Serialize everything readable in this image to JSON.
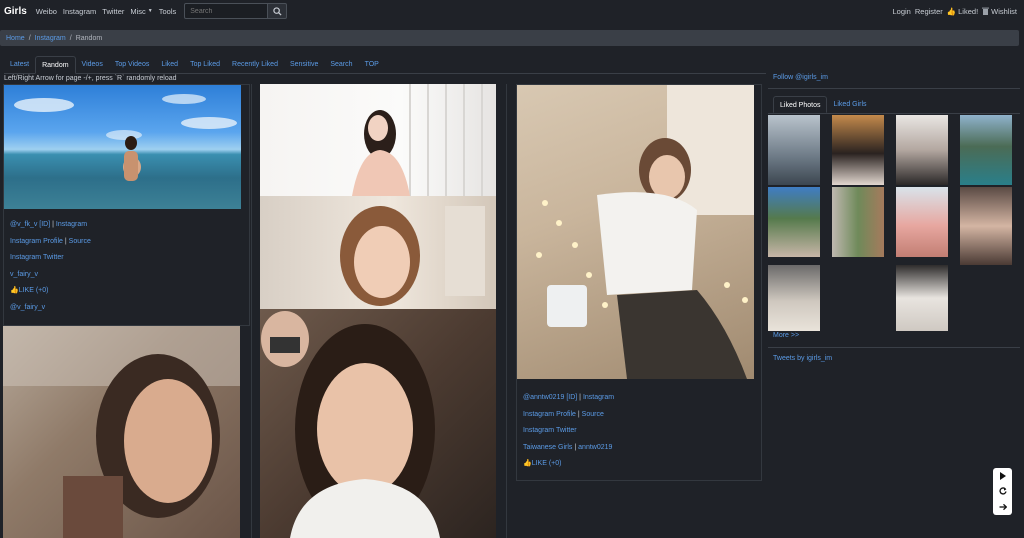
{
  "navbar": {
    "brand": "Girls",
    "links": [
      "Weibo",
      "Instagram",
      "Twitter",
      "Misc",
      "Tools"
    ],
    "search_placeholder": "Search",
    "login": "Login",
    "register": "Register",
    "liked": "Liked!",
    "wishlist": "Wishlist"
  },
  "breadcrumb": {
    "home": "Home",
    "section": "Instagram",
    "current": "Random"
  },
  "tabs": [
    "Latest",
    "Random",
    "Videos",
    "Top Videos",
    "Liked",
    "Top Liked",
    "Recently Liked",
    "Sensitive",
    "Search",
    "TOP"
  ],
  "active_tab": "Random",
  "hint": "Left/Right Arrow for page -/+, press `R` randomly reload",
  "card1": {
    "line1": {
      "handle": "@v_fk_v",
      "id": "[ID]",
      "sep": "|",
      "link": "Instagram"
    },
    "line2": {
      "profile": "Instagram Profile",
      "sep": "|",
      "source": "Source"
    },
    "line3": "Instagram Twitter",
    "line4": "v_fairy_v",
    "like": "LIKE (+0)",
    "line6": "@v_fairy_v"
  },
  "card2": {
    "line1": {
      "handle": "@anntw0219",
      "id": "[ID]",
      "sep": "|",
      "link": "Instagram"
    },
    "line2": {
      "profile": "Instagram Profile",
      "sep": "|",
      "source": "Source"
    },
    "line3": "Instagram Twitter",
    "line4": {
      "group": "Taiwanese Girls",
      "sep": "|",
      "name": "anntw0219"
    },
    "like": "LIKE (+0)"
  },
  "sidebar": {
    "follow": "Follow @igirls_im",
    "tabs": [
      "Liked Photos",
      "Liked Girls"
    ],
    "more": "More >>",
    "tweets": "Tweets by igirls_im"
  },
  "photo_subjects": [
    "woman-wading-in-sea-photo",
    "woman-pink-top-studio-photo",
    "woman-wavy-hair-closeup-photo",
    "woman-grey-top-on-sofa-photo",
    "woman-short-hair-selfie-photo",
    "woman-white-turtleneck-photo"
  ],
  "colors": {
    "accent": "#5b9be6",
    "background": "#1f2228",
    "breadcrumb_bg": "#3a3f47"
  }
}
